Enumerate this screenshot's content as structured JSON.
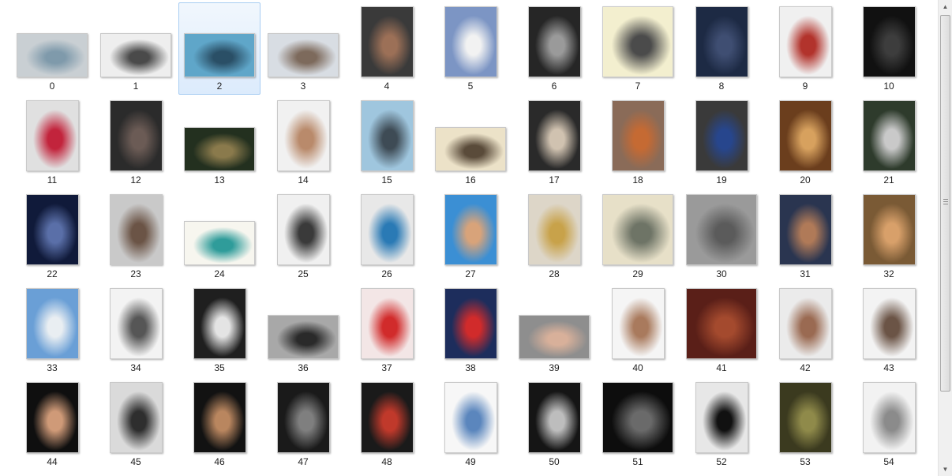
{
  "selected_index": 2,
  "thumbnails": [
    {
      "label": "0",
      "shape": "wide",
      "colors": [
        "#c9cfd3",
        "#7f9aab"
      ]
    },
    {
      "label": "1",
      "shape": "wide",
      "colors": [
        "#eeeeee",
        "#4a4a4a"
      ]
    },
    {
      "label": "2",
      "shape": "wide",
      "colors": [
        "#5fa6c9",
        "#2a4f66"
      ]
    },
    {
      "label": "3",
      "shape": "wide",
      "colors": [
        "#d8dde3",
        "#7d6a5c"
      ]
    },
    {
      "label": "4",
      "shape": "tall",
      "colors": [
        "#3a3a3a",
        "#9c7057"
      ]
    },
    {
      "label": "5",
      "shape": "tall",
      "colors": [
        "#7c95c4",
        "#f2f2f2"
      ]
    },
    {
      "label": "6",
      "shape": "tall",
      "colors": [
        "#262626",
        "#9a9a9a"
      ]
    },
    {
      "label": "7",
      "shape": "square",
      "colors": [
        "#f3efcf",
        "#4b4b4b"
      ]
    },
    {
      "label": "8",
      "shape": "tall",
      "colors": [
        "#1d2a44",
        "#3f4e72"
      ]
    },
    {
      "label": "9",
      "shape": "tall",
      "colors": [
        "#f0f0f0",
        "#b2332c"
      ]
    },
    {
      "label": "10",
      "shape": "tall",
      "colors": [
        "#111111",
        "#3d3d3d"
      ]
    },
    {
      "label": "11",
      "shape": "tall",
      "colors": [
        "#e0e0e0",
        "#c2243c"
      ]
    },
    {
      "label": "12",
      "shape": "tall",
      "colors": [
        "#2b2b2b",
        "#6b5b55"
      ]
    },
    {
      "label": "13",
      "shape": "wide",
      "colors": [
        "#23301f",
        "#8a7a4c"
      ]
    },
    {
      "label": "14",
      "shape": "tall",
      "colors": [
        "#f1f1f1",
        "#b98a6b"
      ]
    },
    {
      "label": "15",
      "shape": "tall",
      "colors": [
        "#9fc6de",
        "#3e4b55"
      ]
    },
    {
      "label": "16",
      "shape": "wide",
      "colors": [
        "#ece2c8",
        "#5a4b3a"
      ]
    },
    {
      "label": "17",
      "shape": "tall",
      "colors": [
        "#2a2a2a",
        "#d0c2b0"
      ]
    },
    {
      "label": "18",
      "shape": "tall",
      "colors": [
        "#8a6b58",
        "#c56a33"
      ]
    },
    {
      "label": "19",
      "shape": "tall",
      "colors": [
        "#3a3a3a",
        "#27468d"
      ]
    },
    {
      "label": "20",
      "shape": "tall",
      "colors": [
        "#6b3e1d",
        "#d7a15e"
      ]
    },
    {
      "label": "21",
      "shape": "tall",
      "colors": [
        "#2e3b2c",
        "#c9c9c9"
      ]
    },
    {
      "label": "22",
      "shape": "tall",
      "colors": [
        "#101a3a",
        "#5a6fa8"
      ]
    },
    {
      "label": "23",
      "shape": "tall",
      "colors": [
        "#c9c9c9",
        "#6b5446"
      ]
    },
    {
      "label": "24",
      "shape": "wide",
      "colors": [
        "#f7f6ef",
        "#2f9c9a"
      ]
    },
    {
      "label": "25",
      "shape": "tall",
      "colors": [
        "#f0f0f0",
        "#3a3a3a"
      ]
    },
    {
      "label": "26",
      "shape": "tall",
      "colors": [
        "#e8e8e8",
        "#2a7ab5"
      ]
    },
    {
      "label": "27",
      "shape": "tall",
      "colors": [
        "#3b8fd4",
        "#d8a37a"
      ]
    },
    {
      "label": "28",
      "shape": "tall",
      "colors": [
        "#ddd6c8",
        "#c8a24a"
      ]
    },
    {
      "label": "29",
      "shape": "square",
      "colors": [
        "#e7e0c8",
        "#6e7466"
      ]
    },
    {
      "label": "30",
      "shape": "square",
      "colors": [
        "#9a9a9a",
        "#5b5b5b"
      ]
    },
    {
      "label": "31",
      "shape": "tall",
      "colors": [
        "#2a3550",
        "#b07a58"
      ]
    },
    {
      "label": "32",
      "shape": "tall",
      "colors": [
        "#7a5a35",
        "#d8a06a"
      ]
    },
    {
      "label": "33",
      "shape": "tall",
      "colors": [
        "#6a9fd6",
        "#e9eef2"
      ]
    },
    {
      "label": "34",
      "shape": "tall",
      "colors": [
        "#f3f3f3",
        "#565656"
      ]
    },
    {
      "label": "35",
      "shape": "tall",
      "colors": [
        "#1f1f1f",
        "#e4e4e4"
      ]
    },
    {
      "label": "36",
      "shape": "wide",
      "colors": [
        "#a8a8a8",
        "#2a2a2a"
      ]
    },
    {
      "label": "37",
      "shape": "tall",
      "colors": [
        "#f3e6e6",
        "#d12b2b"
      ]
    },
    {
      "label": "38",
      "shape": "tall",
      "colors": [
        "#1d2d5c",
        "#d12b2b"
      ]
    },
    {
      "label": "39",
      "shape": "wide",
      "colors": [
        "#8e8e8e",
        "#d8b09a"
      ]
    },
    {
      "label": "40",
      "shape": "tall",
      "colors": [
        "#f5f5f5",
        "#a97a5d"
      ]
    },
    {
      "label": "41",
      "shape": "square",
      "colors": [
        "#5a1f18",
        "#a44a2e"
      ]
    },
    {
      "label": "42",
      "shape": "tall",
      "colors": [
        "#ebebeb",
        "#9a6a52"
      ]
    },
    {
      "label": "43",
      "shape": "tall",
      "colors": [
        "#f3f3f3",
        "#6b5446"
      ]
    },
    {
      "label": "44",
      "shape": "tall",
      "colors": [
        "#0f0f0f",
        "#cf9a78"
      ]
    },
    {
      "label": "45",
      "shape": "tall",
      "colors": [
        "#dadada",
        "#2e2e2e"
      ]
    },
    {
      "label": "46",
      "shape": "tall",
      "colors": [
        "#121212",
        "#b9865f"
      ]
    },
    {
      "label": "47",
      "shape": "tall",
      "colors": [
        "#1a1a1a",
        "#7f7f7f"
      ]
    },
    {
      "label": "48",
      "shape": "tall",
      "colors": [
        "#1a1a1a",
        "#c0392b"
      ]
    },
    {
      "label": "49",
      "shape": "tall",
      "colors": [
        "#f7f7f7",
        "#5b86bd"
      ]
    },
    {
      "label": "50",
      "shape": "tall",
      "colors": [
        "#151515",
        "#bdbdbd"
      ]
    },
    {
      "label": "51",
      "shape": "square",
      "colors": [
        "#0d0d0d",
        "#6a6a6a"
      ]
    },
    {
      "label": "52",
      "shape": "tall",
      "colors": [
        "#e7e7e7",
        "#111111"
      ]
    },
    {
      "label": "53",
      "shape": "tall",
      "colors": [
        "#3b3a1f",
        "#8f8a4a"
      ]
    },
    {
      "label": "54",
      "shape": "tall",
      "colors": [
        "#f2f2f2",
        "#8b8b8b"
      ]
    }
  ],
  "scrollbar": {
    "up_glyph": "▲",
    "down_glyph": "▼",
    "position": 0.0
  }
}
